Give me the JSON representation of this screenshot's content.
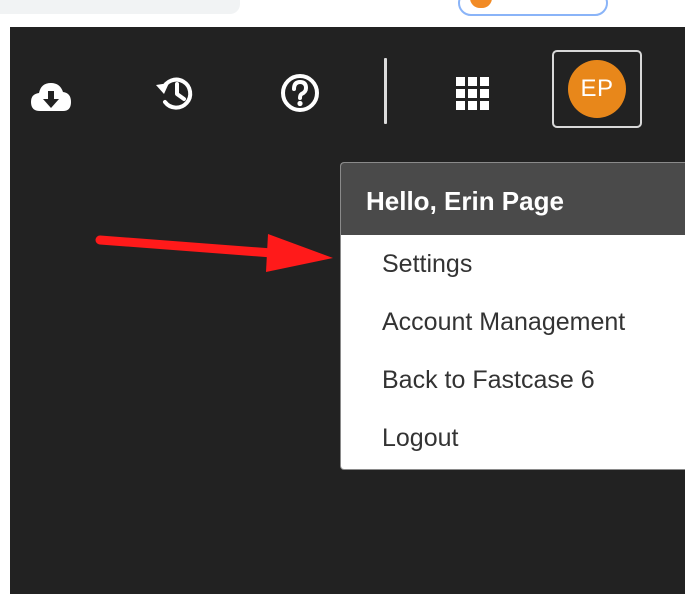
{
  "toolbar": {
    "icons": {
      "download": "cloud-download-icon",
      "history": "history-icon",
      "help": "help-circle-icon",
      "apps": "apps-grid-icon"
    },
    "avatar_initials": "EP",
    "avatar_color": "#e8871a"
  },
  "user_menu": {
    "greeting": "Hello, Erin Page",
    "items": [
      {
        "label": "Settings"
      },
      {
        "label": "Account Management"
      },
      {
        "label": "Back to Fastcase 6"
      },
      {
        "label": "Logout"
      }
    ]
  },
  "annotation": {
    "arrow_color": "#ff1a1a"
  }
}
